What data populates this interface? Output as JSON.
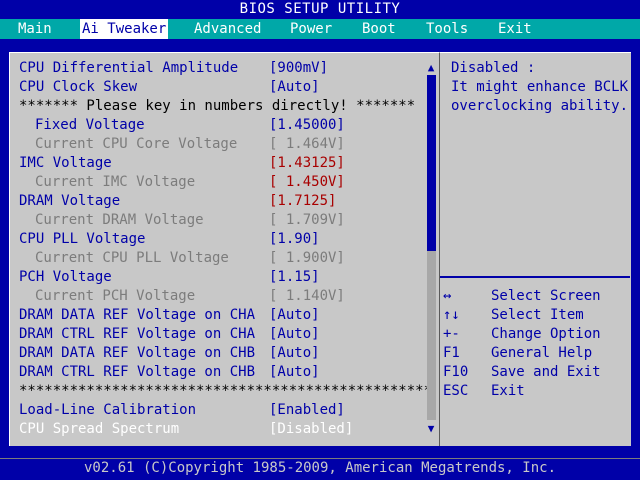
{
  "title": "BIOS SETUP UTILITY",
  "menu": [
    "Main",
    "Ai Tweaker",
    "Advanced",
    "Power",
    "Boot",
    "Tools",
    "Exit"
  ],
  "active_menu": "Ai Tweaker",
  "settings": [
    {
      "label": "CPU Differential Amplitude",
      "value": "[900mV]"
    },
    {
      "label": "CPU Clock Skew",
      "value": "[Auto]"
    },
    {
      "label": "******* Please key in numbers directly! *******",
      "value": ""
    },
    {
      "label": "Fixed Voltage",
      "value": "[1.45000]"
    },
    {
      "label": "Current CPU Core Voltage",
      "value": "[ 1.464V]"
    },
    {
      "label": "IMC Voltage",
      "value": "[1.43125]"
    },
    {
      "label": "Current IMC Voltage",
      "value": "[ 1.450V]"
    },
    {
      "label": "DRAM Voltage",
      "value": "[1.7125]"
    },
    {
      "label": "Current DRAM Voltage",
      "value": "[ 1.709V]"
    },
    {
      "label": "CPU PLL Voltage",
      "value": "[1.90]"
    },
    {
      "label": "Current CPU PLL Voltage",
      "value": "[ 1.900V]"
    },
    {
      "label": "PCH Voltage",
      "value": "[1.15]"
    },
    {
      "label": "Current PCH Voltage",
      "value": "[ 1.140V]"
    },
    {
      "label": "DRAM DATA REF Voltage on CHA",
      "value": "[Auto]"
    },
    {
      "label": "DRAM CTRL REF Voltage on CHA",
      "value": "[Auto]"
    },
    {
      "label": "DRAM DATA REF Voltage on CHB",
      "value": "[Auto]"
    },
    {
      "label": "DRAM CTRL REF Voltage on CHB",
      "value": "[Auto]"
    },
    {
      "label": "*************************************************",
      "value": ""
    },
    {
      "label": "Load-Line Calibration",
      "value": "[Enabled]"
    },
    {
      "label": "CPU Spread Spectrum",
      "value": "[Disabled]"
    }
  ],
  "help": {
    "lines": [
      "Disabled :",
      "It might enhance BCLK",
      "overclocking ability."
    ],
    "keys": [
      {
        "key": "↔",
        "desc": "Select Screen"
      },
      {
        "key": "↑↓",
        "desc": "Select Item"
      },
      {
        "key": "+-",
        "desc": "Change Option"
      },
      {
        "key": "F1",
        "desc": "General Help"
      },
      {
        "key": "F10",
        "desc": "Save and Exit"
      },
      {
        "key": "ESC",
        "desc": "Exit"
      }
    ]
  },
  "scrollbar": {
    "up_icon": "▲",
    "down_icon": "▼"
  },
  "footer": "v02.61 (C)Copyright 1985-2009, American Megatrends, Inc.",
  "colors": {
    "background": "#0000a8",
    "panel": "#c8c8c8",
    "menubar": "#00a8a8",
    "alert": "#a80000"
  }
}
